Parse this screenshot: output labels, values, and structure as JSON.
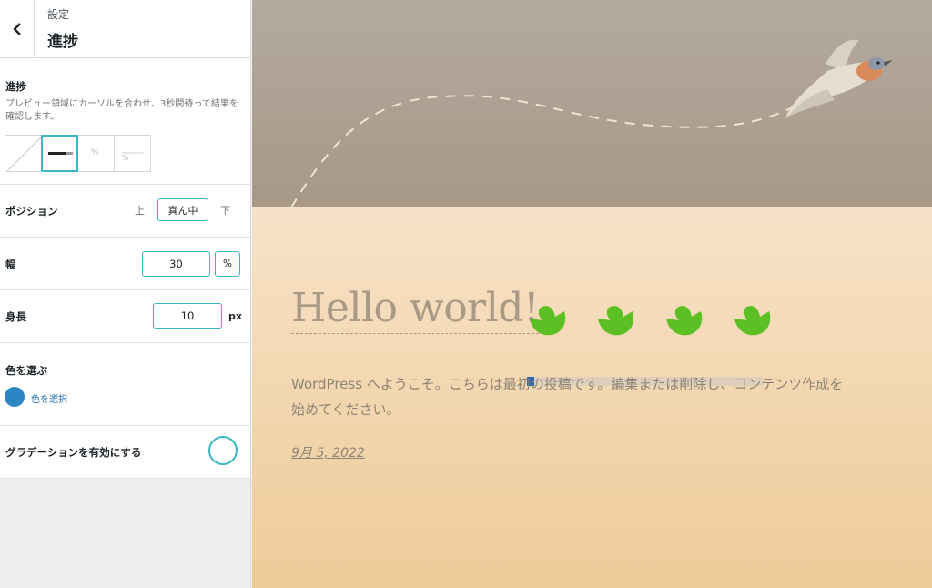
{
  "sidebar": {
    "breadcrumb": "設定",
    "title": "進捗",
    "progress": {
      "label": "進捗",
      "description": "プレビュー領域にカーソルを合わせ、3秒間待って結果を確認します。",
      "style_options": [
        {
          "name": "none",
          "text": ""
        },
        {
          "name": "bar",
          "text": ""
        },
        {
          "name": "percent",
          "text": "%"
        },
        {
          "name": "percent-line",
          "text": "%"
        }
      ]
    },
    "position": {
      "label": "ポジション",
      "options": [
        "上",
        "真ん中",
        "下"
      ],
      "selected": "真ん中"
    },
    "width": {
      "label": "幅",
      "value": "30",
      "unit": "%"
    },
    "height": {
      "label": "身長",
      "value": "10",
      "unit": "px"
    },
    "color": {
      "label": "色を選ぶ",
      "swatch": "#2b86c6",
      "link": "色を選択"
    },
    "gradient": {
      "label": "グラデーションを有効にする"
    }
  },
  "preview": {
    "post_title": "Hello world!",
    "excerpt": "WordPress へようこそ。こちらは最初の投稿です。編集または削除し、コンテンツ作成を始めてください。",
    "date": "9月 5, 2022",
    "progress_value": 0.05,
    "bird_color": "#5cbf24",
    "accent_color": "#3bb7c6"
  }
}
